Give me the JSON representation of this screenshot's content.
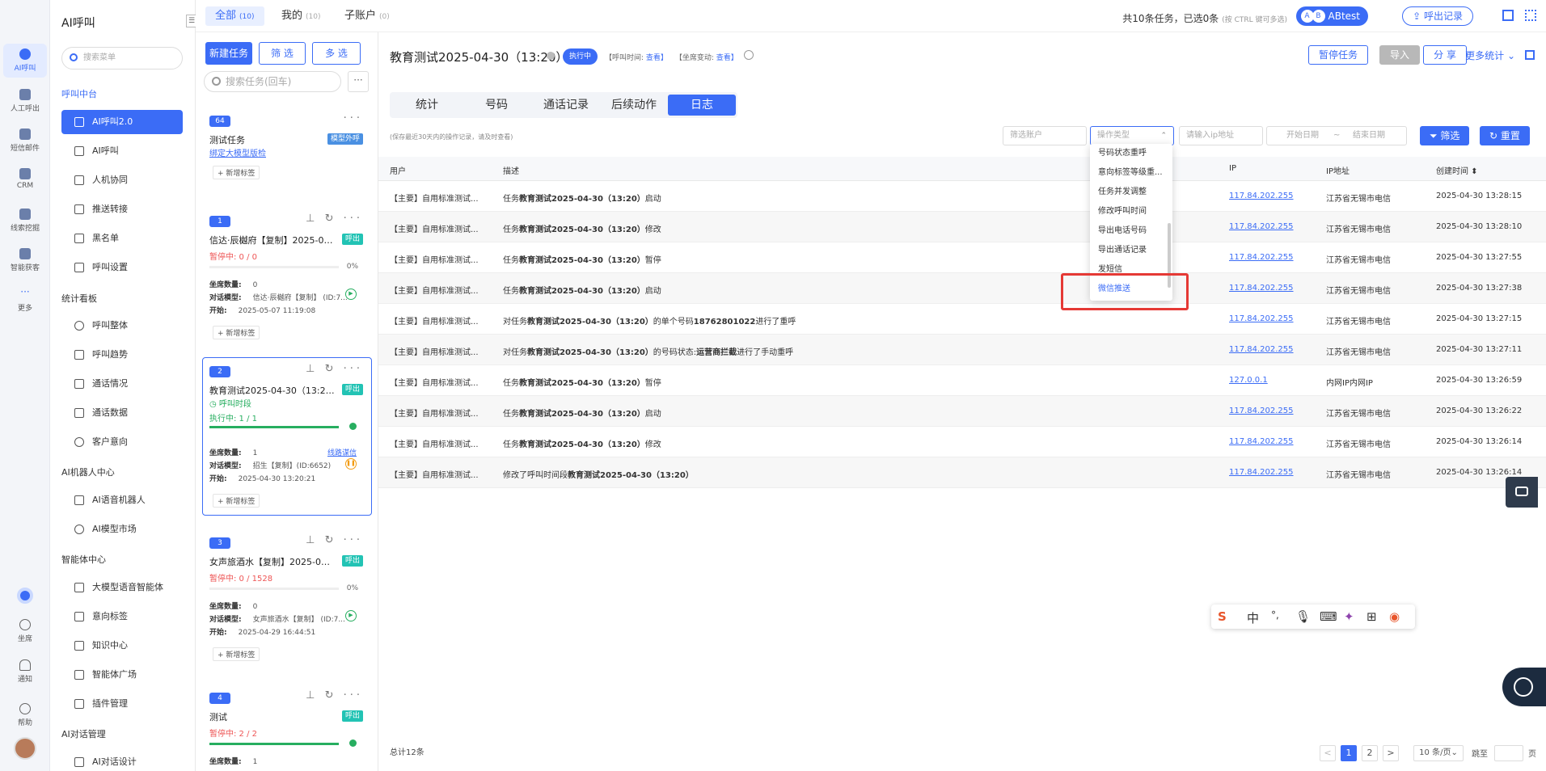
{
  "rail": {
    "items": [
      "AI呼叫",
      "人工呼出",
      "短信邮件",
      "CRM",
      "线索挖掘",
      "智能获客",
      "更多"
    ],
    "bottom": [
      "坐席",
      "通知",
      "帮助"
    ]
  },
  "menu": {
    "title": "AI呼叫",
    "search_placeholder": "搜索菜单",
    "groups": {
      "call_center": "呼叫中台",
      "stats": "统计看板",
      "robot": "AI机器人中心",
      "agent": "智能体中心",
      "dialog": "AI对话管理"
    },
    "items": {
      "ai2": "AI呼叫2.0",
      "ai": "AI呼叫",
      "collab": "人机协同",
      "forward": "推送转接",
      "blacklist": "黑名单",
      "settings": "呼叫设置",
      "overall": "呼叫整体",
      "trend": "呼叫趋势",
      "call_status": "通话情况",
      "call_data": "通话数据",
      "intent": "客户意向",
      "voice_robot": "AI语音机器人",
      "model_market": "AI模型市场",
      "llm_agent": "大模型语音智能体",
      "intent_tag": "意向标签",
      "knowledge": "知识中心",
      "agent_plaza": "智能体广场",
      "plugin": "插件管理",
      "dialog_design": "AI对话设计"
    }
  },
  "topbar": {
    "tabs": [
      {
        "label": "全部",
        "count": "(10)"
      },
      {
        "label": "我的",
        "count": "(10)"
      },
      {
        "label": "子账户",
        "count": "(0)"
      }
    ],
    "summary": "共10条任务，已选0条",
    "summary_hint": "(按 CTRL 键可多选)",
    "abtest": "ABtest",
    "ab_a": "A",
    "ab_b": "B",
    "export_log": "呼出记录"
  },
  "tasks": {
    "new_btn": "新建任务",
    "filter_btn": "筛 选",
    "multi_btn": "多 选",
    "search_placeholder": "搜索任务(回车)",
    "more": "···",
    "add_tag": "+ 新增标签",
    "seat_label": "坐席数量:",
    "model_label": "对话模型:",
    "start_label": "开始:",
    "card0": {
      "badge": "64",
      "name": "测试任务",
      "tag": "模型外呼",
      "link": "绑定大模型版检"
    },
    "card1": {
      "badge": "1",
      "name": "信达·辰樾府【复制】2025-05-...",
      "tag": "呼出",
      "status": "暂停中: 0 / 0",
      "pct": "0%",
      "progress": 0,
      "seats": "0",
      "model": "信达·辰樾府【复制】 (ID:7...",
      "start": "2025-05-07 11:19:08"
    },
    "card2": {
      "badge": "2",
      "name": "教育测试2025-04-30（13:20）",
      "tag": "呼出",
      "period": "呼叫时段",
      "status": "执行中: 1 / 1",
      "progress": 100,
      "seats": "1",
      "model": "招生【复制】(ID:6652)",
      "start": "2025-04-30 13:20:21",
      "link": "线路谋信"
    },
    "card3": {
      "badge": "3",
      "name": "女声旅酒水【复制】2025-04-2...",
      "tag": "呼出",
      "status": "暂停中: 0 / 1528",
      "pct": "0%",
      "progress": 0,
      "seats": "0",
      "model": "女声旅酒水【复制】 (ID:7...",
      "start": "2025-04-29 16:44:51"
    },
    "card4": {
      "badge": "4",
      "name": "测试",
      "tag": "呼出",
      "status": "暂停中: 2 / 2",
      "progress": 100,
      "seats": "1"
    }
  },
  "main": {
    "title": "教育测试2025-04-30（13:20）",
    "status": "执行中",
    "meta_call_time": "【呼叫时间:",
    "meta_view": "查看】",
    "meta_seat": "【坐席变动:",
    "meta_view2": "查看】",
    "pause_btn": "暂停任务",
    "import_btn": "导入",
    "share_btn": "分 享",
    "more_stats": "更多统计 ⌄",
    "tabs": [
      "统计",
      "号码",
      "通话记录",
      "后续动作",
      "日志"
    ],
    "hint": "(保存最近30天内的操作记录，请及时查看)",
    "filter": {
      "account_ph": "筛选账户",
      "optype_ph": "操作类型",
      "ip_ph": "请输入ip地址",
      "start_ph": "开始日期",
      "sep": "~",
      "end_ph": "结束日期",
      "filter_btn": "筛选",
      "reset_btn": "重置"
    },
    "dropdown": [
      "号码状态重呼",
      "意向标签等级重...",
      "任务并发调整",
      "修改呼叫时间",
      "导出电话号码",
      "导出通话记录",
      "发短信",
      "微信推送"
    ],
    "table": {
      "headers": [
        "用户",
        "描述",
        "IP",
        "IP地址",
        "创建时间 ⬍"
      ],
      "rows": [
        {
          "user": "【主要】自用标准测试...",
          "desc_a": "任务",
          "desc_b": "教育测试2025-04-30（13:20）",
          "desc_c": "启动",
          "ip": "117.84.202.255",
          "loc": "江苏省无锡市电信",
          "time": "2025-04-30 13:28:15"
        },
        {
          "user": "【主要】自用标准测试...",
          "desc_a": "任务",
          "desc_b": "教育测试2025-04-30（13:20）",
          "desc_c": "修改",
          "ip": "117.84.202.255",
          "loc": "江苏省无锡市电信",
          "time": "2025-04-30 13:28:10"
        },
        {
          "user": "【主要】自用标准测试...",
          "desc_a": "任务",
          "desc_b": "教育测试2025-04-30（13:20）",
          "desc_c": "暂停",
          "ip": "117.84.202.255",
          "loc": "江苏省无锡市电信",
          "time": "2025-04-30 13:27:55"
        },
        {
          "user": "【主要】自用标准测试...",
          "desc_a": "任务",
          "desc_b": "教育测试2025-04-30（13:20）",
          "desc_c": "启动",
          "ip": "117.84.202.255",
          "loc": "江苏省无锡市电信",
          "time": "2025-04-30 13:27:38"
        },
        {
          "user": "【主要】自用标准测试...",
          "desc_a": "对任务",
          "desc_b": "教育测试2025-04-30（13:20）",
          "desc_c": "的单个号码",
          "desc_d": "18762801022",
          "desc_e": "进行了重呼",
          "ip": "117.84.202.255",
          "loc": "江苏省无锡市电信",
          "time": "2025-04-30 13:27:15"
        },
        {
          "user": "【主要】自用标准测试...",
          "desc_a": "对任务",
          "desc_b": "教育测试2025-04-30（13:20）",
          "desc_c": "的号码状态:",
          "desc_d": "运营商拦截",
          "desc_e": "进行了手动重呼",
          "ip": "117.84.202.255",
          "loc": "江苏省无锡市电信",
          "time": "2025-04-30 13:27:11"
        },
        {
          "user": "【主要】自用标准测试...",
          "desc_a": "任务",
          "desc_b": "教育测试2025-04-30（13:20）",
          "desc_c": "暂停",
          "ip": "127.0.0.1",
          "loc": "内网IP内网IP",
          "time": "2025-04-30 13:26:59"
        },
        {
          "user": "【主要】自用标准测试...",
          "desc_a": "任务",
          "desc_b": "教育测试2025-04-30（13:20）",
          "desc_c": "启动",
          "ip": "117.84.202.255",
          "loc": "江苏省无锡市电信",
          "time": "2025-04-30 13:26:22"
        },
        {
          "user": "【主要】自用标准测试...",
          "desc_a": "任务",
          "desc_b": "教育测试2025-04-30（13:20）",
          "desc_c": "修改",
          "ip": "117.84.202.255",
          "loc": "江苏省无锡市电信",
          "time": "2025-04-30 13:26:14"
        },
        {
          "user": "【主要】自用标准测试...",
          "desc_a": "修改了呼叫时间段",
          "desc_b": "教育测试2025-04-30（13:20）",
          "desc_c": "",
          "ip": "117.84.202.255",
          "loc": "江苏省无锡市电信",
          "time": "2025-04-30 13:26:14"
        }
      ]
    },
    "footer": {
      "total": "总计12条",
      "prev": "<",
      "page1": "1",
      "page2": "2",
      "next": ">",
      "per_page": "10 条/页⌄",
      "jump": "跳至",
      "page_unit": "页"
    }
  },
  "ime": {
    "zh": "中",
    "dot": "°,"
  }
}
